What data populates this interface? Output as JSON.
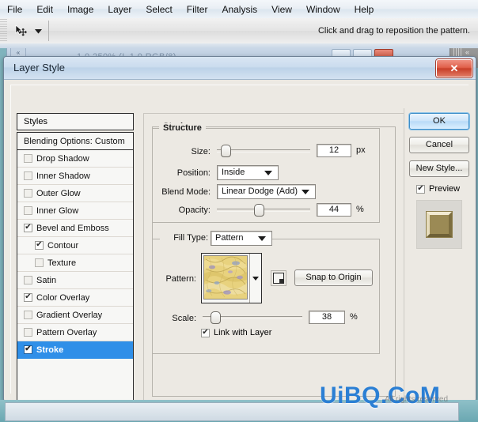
{
  "menubar": {
    "items": [
      {
        "label": "File"
      },
      {
        "label": "Edit"
      },
      {
        "label": "Image"
      },
      {
        "label": "Layer"
      },
      {
        "label": "Select"
      },
      {
        "label": "Filter"
      },
      {
        "label": "Analysis"
      },
      {
        "label": "View"
      },
      {
        "label": "Window"
      },
      {
        "label": "Help"
      }
    ]
  },
  "options_bar": {
    "tool_icon": "move-tool-icon",
    "caret_icon": "chevron-down-icon",
    "hint": "Click and drag to reposition the pattern."
  },
  "document_window": {
    "title": "1 0 250% (L       1 0  RGB/8)",
    "grip_icon": "double-chevron-left-icon",
    "minimize_label": "",
    "maximize_label": "",
    "close_label": ""
  },
  "dialog": {
    "title": "Layer Style",
    "close_label": "✕",
    "close_icon": "close-icon"
  },
  "styles_panel": {
    "header": "Styles",
    "items": [
      {
        "label": "Blending Options: Custom",
        "checkbox": false,
        "has_checkbox": false,
        "indent": false,
        "selected": false
      },
      {
        "label": "Drop Shadow",
        "checkbox": false,
        "has_checkbox": true,
        "indent": false,
        "selected": false
      },
      {
        "label": "Inner Shadow",
        "checkbox": false,
        "has_checkbox": true,
        "indent": false,
        "selected": false
      },
      {
        "label": "Outer Glow",
        "checkbox": false,
        "has_checkbox": true,
        "indent": false,
        "selected": false
      },
      {
        "label": "Inner Glow",
        "checkbox": false,
        "has_checkbox": true,
        "indent": false,
        "selected": false
      },
      {
        "label": "Bevel and Emboss",
        "checkbox": true,
        "has_checkbox": true,
        "indent": false,
        "selected": false
      },
      {
        "label": "Contour",
        "checkbox": true,
        "has_checkbox": true,
        "indent": true,
        "selected": false
      },
      {
        "label": "Texture",
        "checkbox": false,
        "has_checkbox": true,
        "indent": true,
        "selected": false
      },
      {
        "label": "Satin",
        "checkbox": false,
        "has_checkbox": true,
        "indent": false,
        "selected": false
      },
      {
        "label": "Color Overlay",
        "checkbox": true,
        "has_checkbox": true,
        "indent": false,
        "selected": false
      },
      {
        "label": "Gradient Overlay",
        "checkbox": false,
        "has_checkbox": true,
        "indent": false,
        "selected": false
      },
      {
        "label": "Pattern Overlay",
        "checkbox": false,
        "has_checkbox": true,
        "indent": false,
        "selected": false
      },
      {
        "label": "Stroke",
        "checkbox": true,
        "has_checkbox": true,
        "indent": false,
        "selected": true
      }
    ]
  },
  "stroke": {
    "group_label": "Stroke",
    "structure": {
      "label": "Structure",
      "size_label": "Size:",
      "size_value": "12",
      "size_unit": "px",
      "size_slider_percent": 8,
      "position_label": "Position:",
      "position_value": "Inside",
      "blend_mode_label": "Blend Mode:",
      "blend_mode_value": "Linear Dodge (Add)",
      "opacity_label": "Opacity:",
      "opacity_value": "44",
      "opacity_unit": "%",
      "opacity_slider_percent": 44
    },
    "fill": {
      "fill_type_label": "Fill Type:",
      "fill_type_value": "Pattern",
      "pattern_label": "Pattern:",
      "pattern_preset_icon": "new-preset-icon",
      "snap_to_origin_label": "Snap to Origin",
      "scale_label": "Scale:",
      "scale_value": "38",
      "scale_unit": "%",
      "scale_slider_percent": 12,
      "link_with_layer_label": "Link with Layer",
      "link_with_layer_checked": true
    }
  },
  "buttons": {
    "ok": "OK",
    "cancel": "Cancel",
    "new_style": "New Style...",
    "preview_label": "Preview",
    "preview_checked": true
  },
  "watermark": {
    "text": "UiBQ.CoM",
    "subtext": "All rights reserved"
  },
  "colors": {
    "selection_blue": "#2f8fe8",
    "dialog_bg": "#ece9e3",
    "titlebar_blue": "#cbdcee",
    "close_red": "#c83f29",
    "watermark_blue": "#2b7fd4",
    "desktop_teal": "#7fb3bd"
  }
}
